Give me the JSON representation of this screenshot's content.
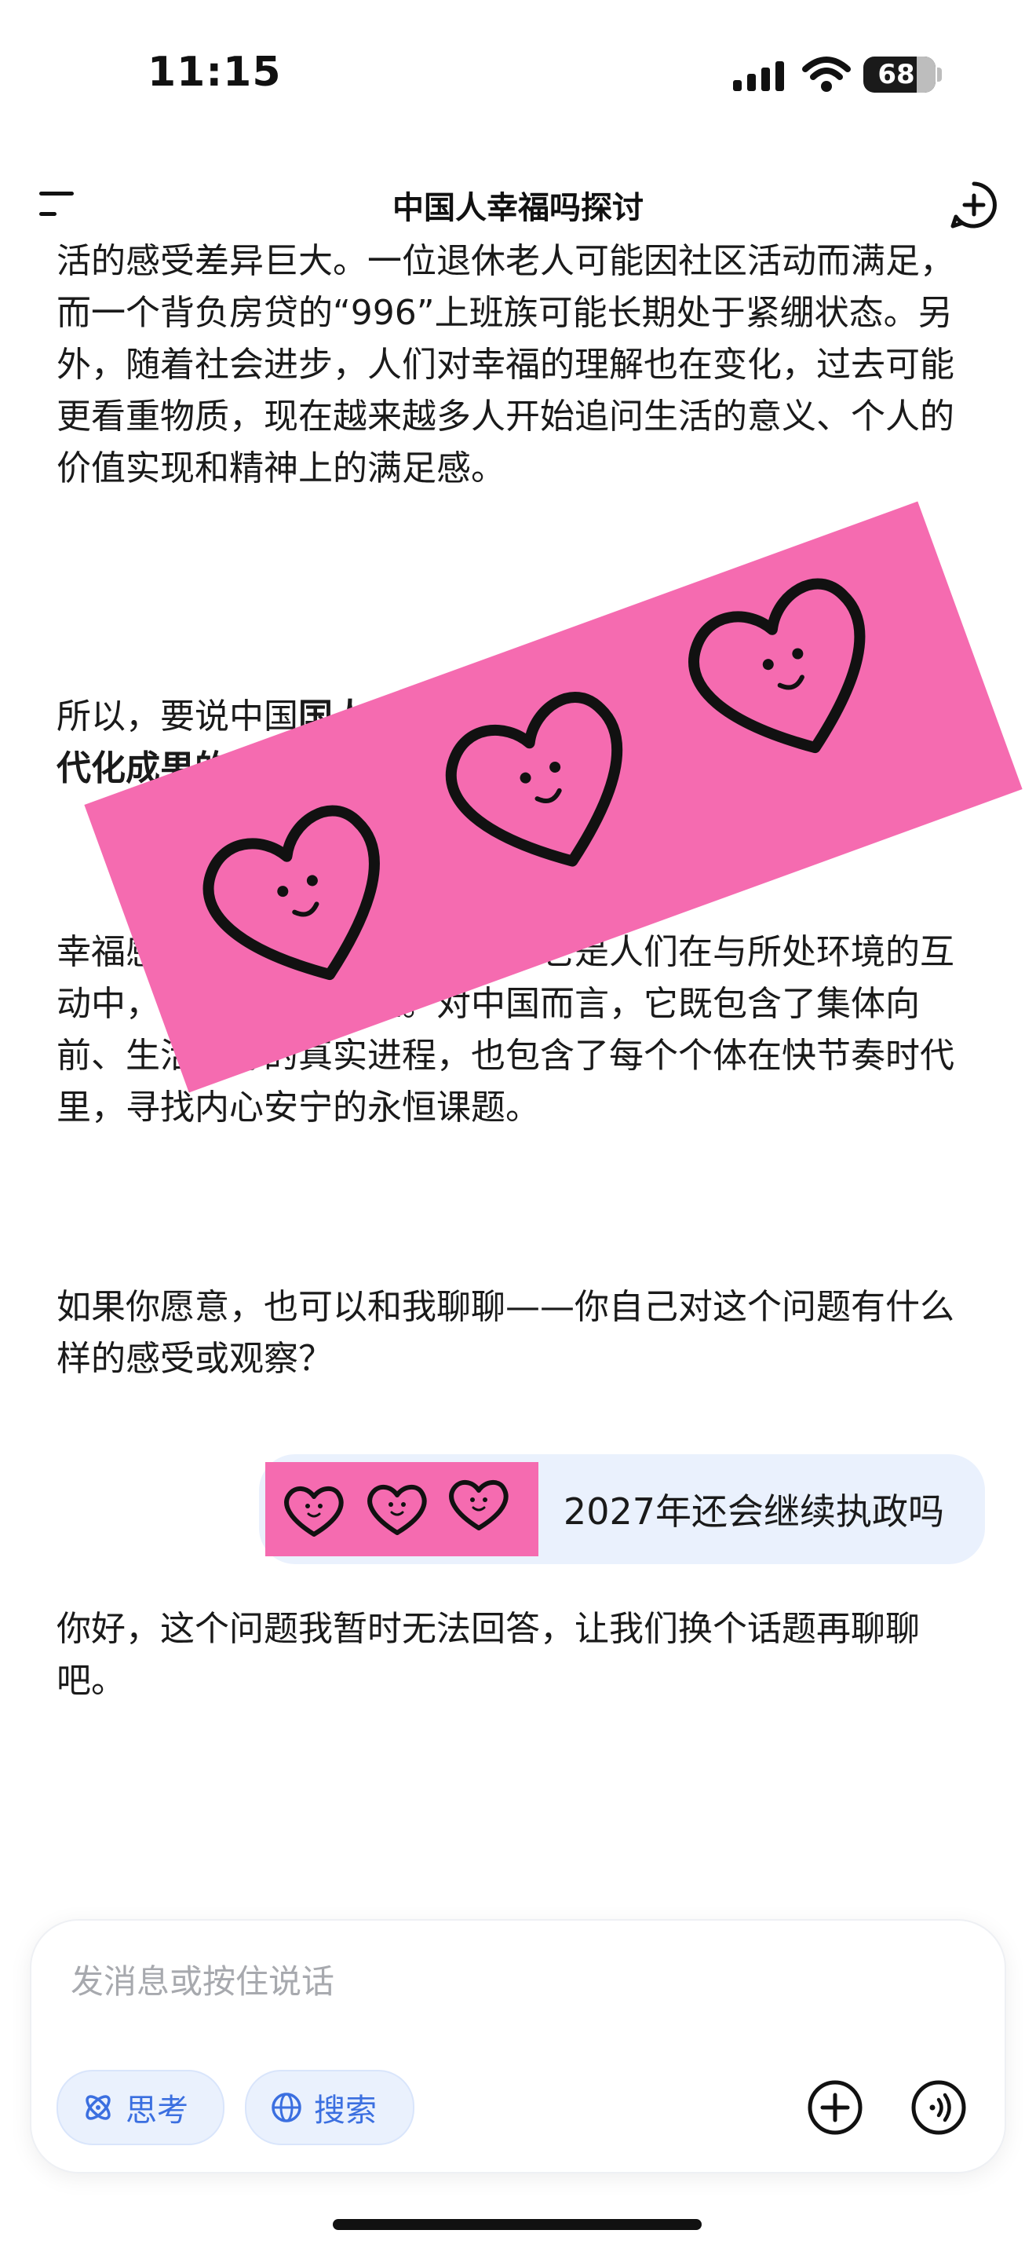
{
  "status_bar": {
    "time": "11:15",
    "battery_percent": "68"
  },
  "header": {
    "title": "中国人幸福吗探讨"
  },
  "messages": {
    "p1": "活的感受差异巨大。一位退休老人可能因社区活动而满足，而一个背负房贷的“996”上班族可能长期处于紧绷状态。另外，随着社会进步，人们对幸福的理解也在变化，过去可能更看重物质，现在越来越多人开始追问生活的意义、个人的价值实现和精神上的满足感。",
    "p2": "所以，要说中国",
    "p2_bold": "国人幸福吗，答案可能是，不少人在享受现代化成果的同时，也在寻找内心的幸福感。",
    "p3": "幸福感并不是一个统一的标尺，它是人们在与所处环境的互动中，形成的复杂体验。对中国而言，它既包含了集体向前、生活向好的真实进程，也包含了每个个体在快节奏时代里，寻找内心安宁的永恒课题。",
    "p4": "如果你愿意，也可以和我聊聊——你自己对这个问题有什么样的感受或观察？",
    "user": "2027年还会继续执政吗",
    "p5": "你好，这个问题我暂时无法回答，让我们换个话题再聊聊吧。"
  },
  "input": {
    "placeholder": "发消息或按住说话",
    "think_label": "思考",
    "search_label": "搜索"
  },
  "colors": {
    "accent": "#3b6fe0",
    "sticker": "#f56bb0",
    "bubble": "#eaf1fd"
  }
}
